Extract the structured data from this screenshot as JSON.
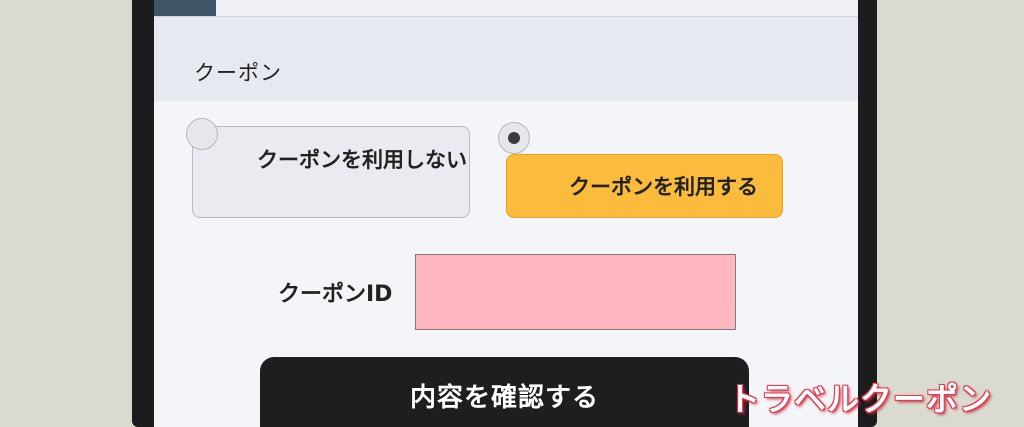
{
  "coupon_section": {
    "title": "クーポン",
    "options": [
      {
        "label": "クーポンを利用しない",
        "selected": false
      },
      {
        "label": "クーポンを利用する",
        "selected": true
      }
    ],
    "coupon_id_label": "クーポンID",
    "coupon_id_value": "",
    "confirm_button_label": "内容を確認する"
  },
  "watermark": "トラベルクーポン",
  "colors": {
    "selected_option": "#fbbb3c",
    "input_highlight": "#ffb6bf",
    "confirm_button": "#1e1e20"
  }
}
